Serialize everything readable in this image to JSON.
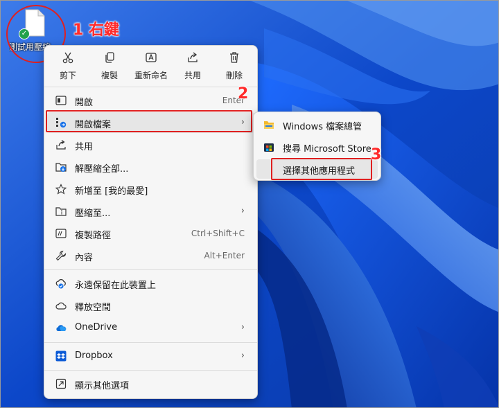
{
  "desktop": {
    "file_label": "測試用壓縮"
  },
  "annotations": {
    "step1": "1 右鍵",
    "step2": "2",
    "step3": "3"
  },
  "toolbar": {
    "cut": {
      "label": "剪下",
      "icon": "scissors-icon"
    },
    "copy": {
      "label": "複製",
      "icon": "copy-icon"
    },
    "rename": {
      "label": "重新命名",
      "icon": "rename-icon"
    },
    "share": {
      "label": "共用",
      "icon": "share-icon"
    },
    "delete": {
      "label": "刪除",
      "icon": "trash-icon"
    }
  },
  "menu": {
    "items": [
      {
        "label": "開啟",
        "shortcut": "Enter",
        "icon": "open-icon"
      },
      {
        "label": "開啟檔案",
        "icon": "open-with-icon",
        "submenu": true
      },
      {
        "label": "共用",
        "icon": "share-icon"
      },
      {
        "label": "解壓縮全部...",
        "icon": "extract-icon"
      },
      {
        "label": "新增至 [我的最愛]",
        "icon": "star-icon"
      },
      {
        "label": "壓縮至...",
        "icon": "compress-icon",
        "submenu": true
      },
      {
        "label": "複製路徑",
        "shortcut": "Ctrl+Shift+C",
        "icon": "copy-path-icon"
      },
      {
        "label": "內容",
        "shortcut": "Alt+Enter",
        "icon": "wrench-icon"
      },
      {
        "label": "永遠保留在此裝置上",
        "icon": "cloud-check-icon"
      },
      {
        "label": "釋放空間",
        "icon": "cloud-icon"
      },
      {
        "label": "OneDrive",
        "icon": "onedrive-icon",
        "submenu": true
      },
      {
        "label": "Dropbox",
        "icon": "dropbox-icon",
        "submenu": true
      },
      {
        "label": "顯示其他選項",
        "icon": "more-options-icon"
      }
    ]
  },
  "submenu": {
    "items": [
      {
        "label": "Windows 檔案總管",
        "icon": "folder-icon"
      },
      {
        "label": "搜尋 Microsoft Store",
        "icon": "store-icon"
      },
      {
        "label": "選擇其他應用程式",
        "icon": ""
      }
    ]
  },
  "colors": {
    "annotation_red": "#e02020",
    "menu_bg": "#f6f6f6",
    "wallpaper_blue": "#0a4fd8"
  }
}
